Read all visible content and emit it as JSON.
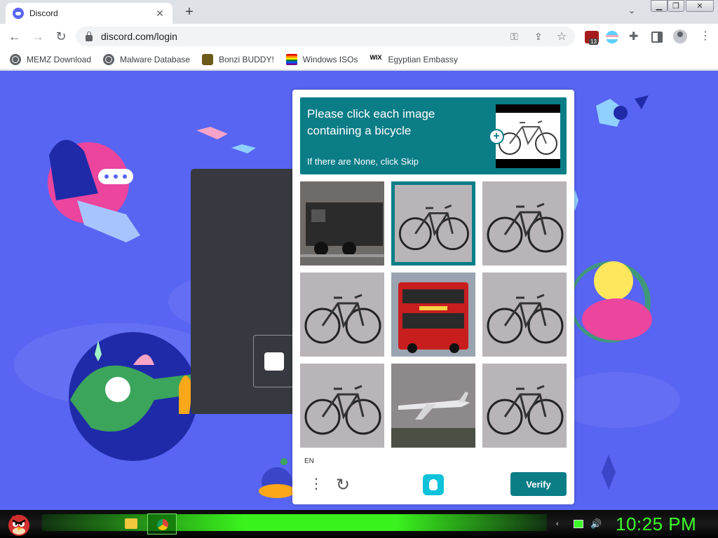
{
  "browser": {
    "tab_title": "Discord",
    "url": "discord.com/login",
    "extension_badge": "13"
  },
  "bookmarks": [
    {
      "label": "MEMZ Download",
      "icon": "globe-icon"
    },
    {
      "label": "Malware Database",
      "icon": "globe-icon"
    },
    {
      "label": "Bonzi BUDDY!",
      "icon": "bonzi-icon"
    },
    {
      "label": "Windows ISOs",
      "icon": "rainbow-icon"
    },
    {
      "label": "Egyptian Embassy",
      "icon": "wix-icon"
    }
  ],
  "captcha": {
    "prompt": "Please click each image containing a bicycle",
    "hint": "If there are None, click Skip",
    "language": "EN",
    "verify_label": "Verify",
    "tiles": [
      {
        "content": "train",
        "selected": false
      },
      {
        "content": "bicycle",
        "selected": true
      },
      {
        "content": "bicycle",
        "selected": false
      },
      {
        "content": "bicycle",
        "selected": false
      },
      {
        "content": "bus",
        "selected": false
      },
      {
        "content": "bicycle",
        "selected": false
      },
      {
        "content": "bicycle",
        "selected": false
      },
      {
        "content": "airplane",
        "selected": false
      },
      {
        "content": "bicycle",
        "selected": false
      }
    ]
  },
  "taskbar": {
    "clock": "10:25 PM"
  },
  "colors": {
    "discord_blurple": "#5865f2",
    "captcha_teal": "#0a7d87",
    "clock_green": "#3cff2a"
  }
}
